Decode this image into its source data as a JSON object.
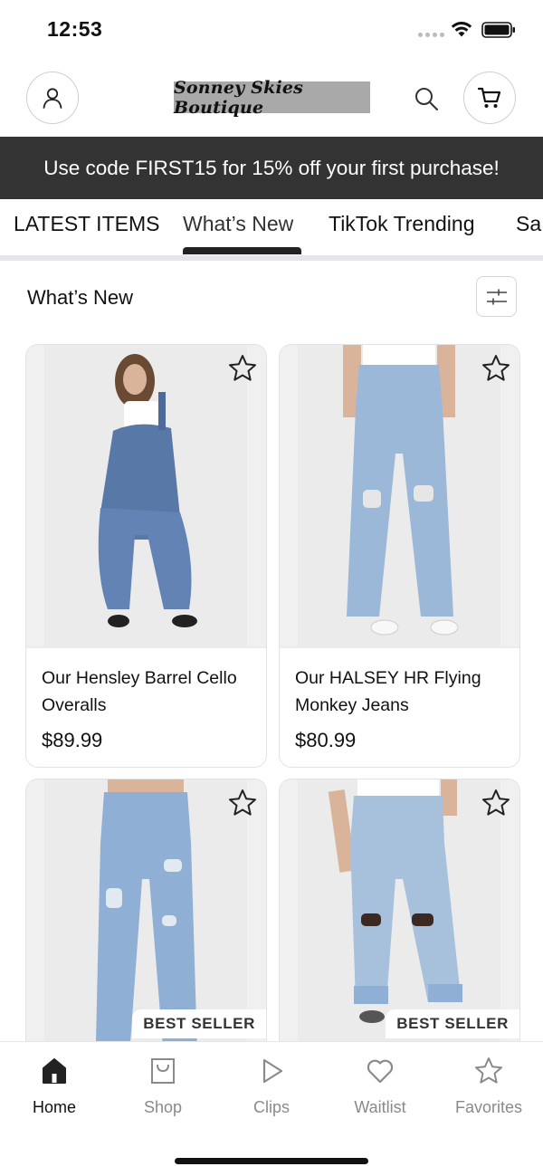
{
  "status_bar": {
    "time": "12:53"
  },
  "header": {
    "logo_text": "Sonney Skies Boutique"
  },
  "promo": {
    "text": "Use code FIRST15 for 15% off your first purchase!"
  },
  "tabs": [
    {
      "label": "LATEST ITEMS",
      "active": false
    },
    {
      "label": "What’s New",
      "active": true
    },
    {
      "label": "TikTok Trending",
      "active": false
    },
    {
      "label": "Sa",
      "active": false
    }
  ],
  "section": {
    "title": "What’s New"
  },
  "products": [
    {
      "name": "Our Hensley Barrel Cello Overalls",
      "price": "$89.99",
      "badge": ""
    },
    {
      "name": "Our HALSEY HR  Flying Monkey Jeans",
      "price": "$80.99",
      "badge": ""
    },
    {
      "name": "",
      "price": "",
      "badge": "BEST SELLER"
    },
    {
      "name": "",
      "price": "",
      "badge": "BEST SELLER"
    }
  ],
  "bottom_nav": [
    {
      "label": "Home",
      "icon": "home-icon",
      "active": true
    },
    {
      "label": "Shop",
      "icon": "shopping-bag-icon",
      "active": false
    },
    {
      "label": "Clips",
      "icon": "play-icon",
      "active": false
    },
    {
      "label": "Waitlist",
      "icon": "heart-icon",
      "active": false
    },
    {
      "label": "Favorites",
      "icon": "star-icon",
      "active": false
    }
  ],
  "colors": {
    "promo_bg": "#333333",
    "accent": "#222222",
    "muted": "#8a8a8a"
  }
}
